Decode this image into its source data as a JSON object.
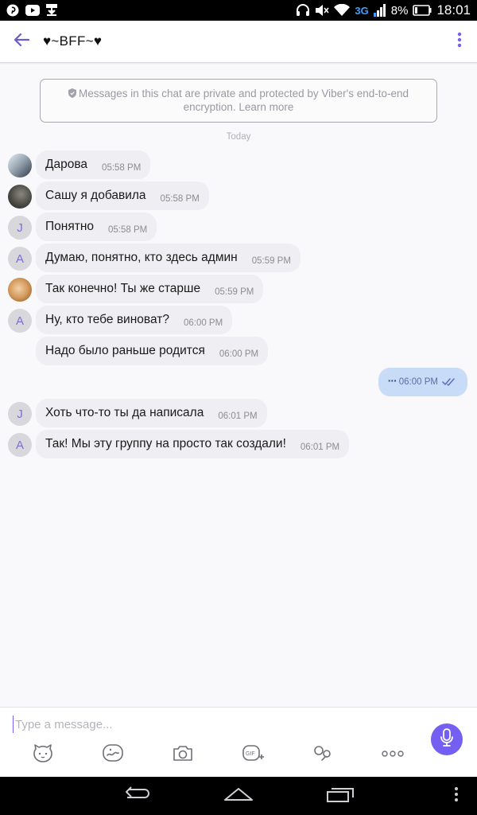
{
  "status_bar": {
    "network": "3G",
    "battery": "8%",
    "time": "18:01",
    "icons": [
      "pinterest-icon",
      "youtube-icon",
      "download-icon",
      "headphones-icon",
      "mute-icon",
      "wifi-icon",
      "signal-icon",
      "battery-icon"
    ]
  },
  "header": {
    "title": "♥~BFF~♥",
    "back_icon": "arrow-left-icon",
    "menu_icon": "more-vertical-icon"
  },
  "encryption_notice": {
    "line1": "Messages in this chat are private and protected by Viber's end-to-end",
    "line2_prefix": "encryption. ",
    "link": "Learn more"
  },
  "day_separator": "Today",
  "messages": [
    {
      "direction": "in",
      "avatar": "photo-1",
      "avatar_letter": "",
      "text": "Дарова",
      "time": "05:58 PM"
    },
    {
      "direction": "in",
      "avatar": "photo-2",
      "avatar_letter": "",
      "text": "Сашу я добавила",
      "time": "05:58 PM"
    },
    {
      "direction": "in",
      "avatar": "letter",
      "avatar_letter": "J",
      "text": "Понятно",
      "time": "05:58 PM"
    },
    {
      "direction": "in",
      "avatar": "letter",
      "avatar_letter": "A",
      "text": "Думаю, понятно, кто здесь админ",
      "time": "05:59 PM"
    },
    {
      "direction": "in",
      "avatar": "photo-3",
      "avatar_letter": "",
      "text": "Так конечно! Ты же старше",
      "time": "05:59 PM"
    },
    {
      "direction": "in",
      "avatar": "letter",
      "avatar_letter": "A",
      "text": "Ну, кто тебе виноват?",
      "time": "06:00 PM"
    },
    {
      "direction": "in",
      "avatar": "none",
      "avatar_letter": "",
      "text": "Надо было раньше родится",
      "time": "06:00 PM"
    },
    {
      "direction": "out",
      "text": "···",
      "time": "06:00 PM",
      "status": "read-ticks"
    },
    {
      "direction": "in",
      "avatar": "letter",
      "avatar_letter": "J",
      "text": "Хоть что-то ты да написала",
      "time": "06:01 PM"
    },
    {
      "direction": "in",
      "avatar": "letter",
      "avatar_letter": "A",
      "text": "Так! Мы эту группу на просто так создали!",
      "time": "06:01 PM"
    }
  ],
  "composer": {
    "placeholder": "Type a message...",
    "tools": [
      "sticker-icon",
      "doodle-icon",
      "camera-icon",
      "gif-icon",
      "location-icon",
      "more-horizontal-icon"
    ],
    "send_icon": "microphone-icon"
  },
  "colors": {
    "accent": "#7360f2",
    "incoming_bubble": "#efeef2",
    "outgoing_bubble": "#c8dbf7"
  }
}
